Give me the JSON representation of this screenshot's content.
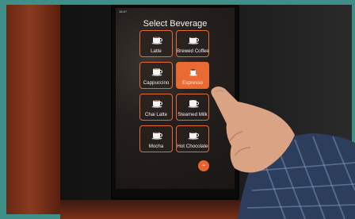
{
  "screen": {
    "title": "Select Beverage",
    "status": "16:47",
    "beverages": [
      {
        "label": "Latte",
        "selected": false
      },
      {
        "label": "Brewed Coffee",
        "selected": false
      },
      {
        "label": "Cappuccino",
        "selected": false
      },
      {
        "label": "Espresso",
        "selected": true
      },
      {
        "label": "Chai Latte",
        "selected": false
      },
      {
        "label": "Steamed Milk",
        "selected": false
      },
      {
        "label": "Mocha",
        "selected": false
      },
      {
        "label": "Hot Chocolate",
        "selected": false
      }
    ],
    "icons": {
      "beverage": "coffee-cup-icon"
    }
  },
  "colors": {
    "accent": "#e8632d",
    "screen_bg": "#241f1c",
    "machine_body": "#7a3018",
    "wall": "#3f8f88"
  }
}
